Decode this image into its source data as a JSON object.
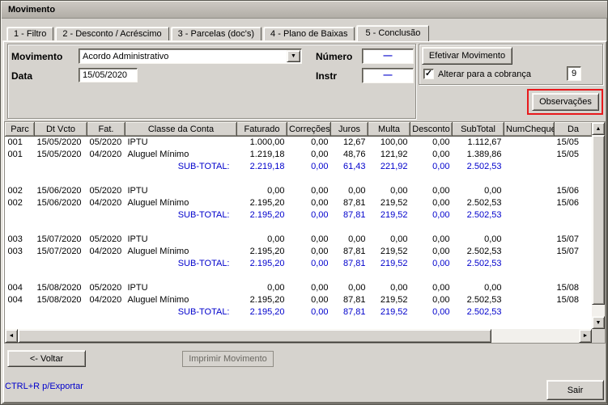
{
  "window": {
    "title": "Movimento"
  },
  "tabs": [
    {
      "key": "filtro",
      "label": "1 - Filtro",
      "active": false
    },
    {
      "key": "desconto-acrescimo",
      "label": "2 - Desconto / Acréscimo",
      "active": false
    },
    {
      "key": "parcelas-docs",
      "label": "3 - Parcelas (doc's)",
      "active": false
    },
    {
      "key": "plano-de-baixas",
      "label": "4 - Plano de Baixas",
      "active": false
    },
    {
      "key": "conclusao",
      "label": "5 - Conclusão",
      "active": true
    }
  ],
  "form": {
    "movimento_label": "Movimento",
    "movimento_value": "Acordo Administrativo",
    "data_label": "Data",
    "data_value": "15/05/2020",
    "numero_label": "Número",
    "numero_value": "—",
    "instr_label": "Instr",
    "instr_value": "—",
    "efetivar_button": "Efetivar Movimento",
    "alterar_label": "Alterar para a cobrança",
    "alterar_checked": true,
    "cobranca_value": "9",
    "observacoes_button": "Observações"
  },
  "table": {
    "columns": [
      "Parc",
      "Dt Vcto",
      "Fat.",
      "Classe da Conta",
      "Faturado",
      "Correções",
      "Juros",
      "Multa",
      "Desconto",
      "SubTotal",
      "NumCheque",
      "Da"
    ],
    "column_keys": [
      "parc",
      "dt-vcto",
      "fat",
      "classe-da-conta",
      "faturado",
      "correcoes",
      "juros",
      "multa",
      "desconto",
      "subtotal",
      "numcheque",
      "data"
    ],
    "rows": [
      {
        "type": "data",
        "cells": [
          "001",
          "15/05/2020",
          "05/2020",
          "IPTU",
          "1.000,00",
          "0,00",
          "12,67",
          "100,00",
          "0,00",
          "1.112,67",
          "",
          "15/05"
        ]
      },
      {
        "type": "data",
        "cells": [
          "001",
          "15/05/2020",
          "04/2020",
          "Aluguel Mínimo",
          "1.219,18",
          "0,00",
          "48,76",
          "121,92",
          "0,00",
          "1.389,86",
          "",
          "15/05"
        ]
      },
      {
        "type": "subtotal",
        "cells": [
          "",
          "",
          "",
          "SUB-TOTAL:",
          "2.219,18",
          "0,00",
          "61,43",
          "221,92",
          "0,00",
          "2.502,53",
          "",
          ""
        ]
      },
      {
        "type": "spacer",
        "cells": [
          "",
          "",
          "",
          "",
          "",
          "",
          "",
          "",
          "",
          "",
          "",
          ""
        ]
      },
      {
        "type": "data",
        "cells": [
          "002",
          "15/06/2020",
          "05/2020",
          "IPTU",
          "0,00",
          "0,00",
          "0,00",
          "0,00",
          "0,00",
          "0,00",
          "",
          "15/06"
        ]
      },
      {
        "type": "data",
        "cells": [
          "002",
          "15/06/2020",
          "04/2020",
          "Aluguel Mínimo",
          "2.195,20",
          "0,00",
          "87,81",
          "219,52",
          "0,00",
          "2.502,53",
          "",
          "15/06"
        ]
      },
      {
        "type": "subtotal",
        "cells": [
          "",
          "",
          "",
          "SUB-TOTAL:",
          "2.195,20",
          "0,00",
          "87,81",
          "219,52",
          "0,00",
          "2.502,53",
          "",
          ""
        ]
      },
      {
        "type": "spacer",
        "cells": [
          "",
          "",
          "",
          "",
          "",
          "",
          "",
          "",
          "",
          "",
          "",
          ""
        ]
      },
      {
        "type": "data",
        "cells": [
          "003",
          "15/07/2020",
          "05/2020",
          "IPTU",
          "0,00",
          "0,00",
          "0,00",
          "0,00",
          "0,00",
          "0,00",
          "",
          "15/07"
        ]
      },
      {
        "type": "data",
        "cells": [
          "003",
          "15/07/2020",
          "04/2020",
          "Aluguel Mínimo",
          "2.195,20",
          "0,00",
          "87,81",
          "219,52",
          "0,00",
          "2.502,53",
          "",
          "15/07"
        ]
      },
      {
        "type": "subtotal",
        "cells": [
          "",
          "",
          "",
          "SUB-TOTAL:",
          "2.195,20",
          "0,00",
          "87,81",
          "219,52",
          "0,00",
          "2.502,53",
          "",
          ""
        ]
      },
      {
        "type": "spacer",
        "cells": [
          "",
          "",
          "",
          "",
          "",
          "",
          "",
          "",
          "",
          "",
          "",
          ""
        ]
      },
      {
        "type": "data",
        "cells": [
          "004",
          "15/08/2020",
          "05/2020",
          "IPTU",
          "0,00",
          "0,00",
          "0,00",
          "0,00",
          "0,00",
          "0,00",
          "",
          "15/08"
        ]
      },
      {
        "type": "data",
        "cells": [
          "004",
          "15/08/2020",
          "04/2020",
          "Aluguel Mínimo",
          "2.195,20",
          "0,00",
          "87,81",
          "219,52",
          "0,00",
          "2.502,53",
          "",
          "15/08"
        ]
      },
      {
        "type": "subtotal",
        "cells": [
          "",
          "",
          "",
          "SUB-TOTAL:",
          "2.195,20",
          "0,00",
          "87,81",
          "219,52",
          "0,00",
          "2.502,53",
          "",
          ""
        ]
      },
      {
        "type": "spacer",
        "cells": [
          "",
          "",
          "",
          "",
          "",
          "",
          "",
          "",
          "",
          "",
          "",
          ""
        ]
      }
    ]
  },
  "footer": {
    "voltar_button": "<- Voltar",
    "imprimir_button": "Imprimir Movimento",
    "export_hint": "CTRL+R p/Exportar",
    "sair_button": "Sair"
  },
  "icons": {
    "dropdown": "▼",
    "check": "✓",
    "scroll_up": "▲",
    "scroll_down": "▼",
    "scroll_left": "◄",
    "scroll_right": "►"
  },
  "colors": {
    "accent_blue": "#0000cc",
    "annotation_red": "#e8191c"
  }
}
